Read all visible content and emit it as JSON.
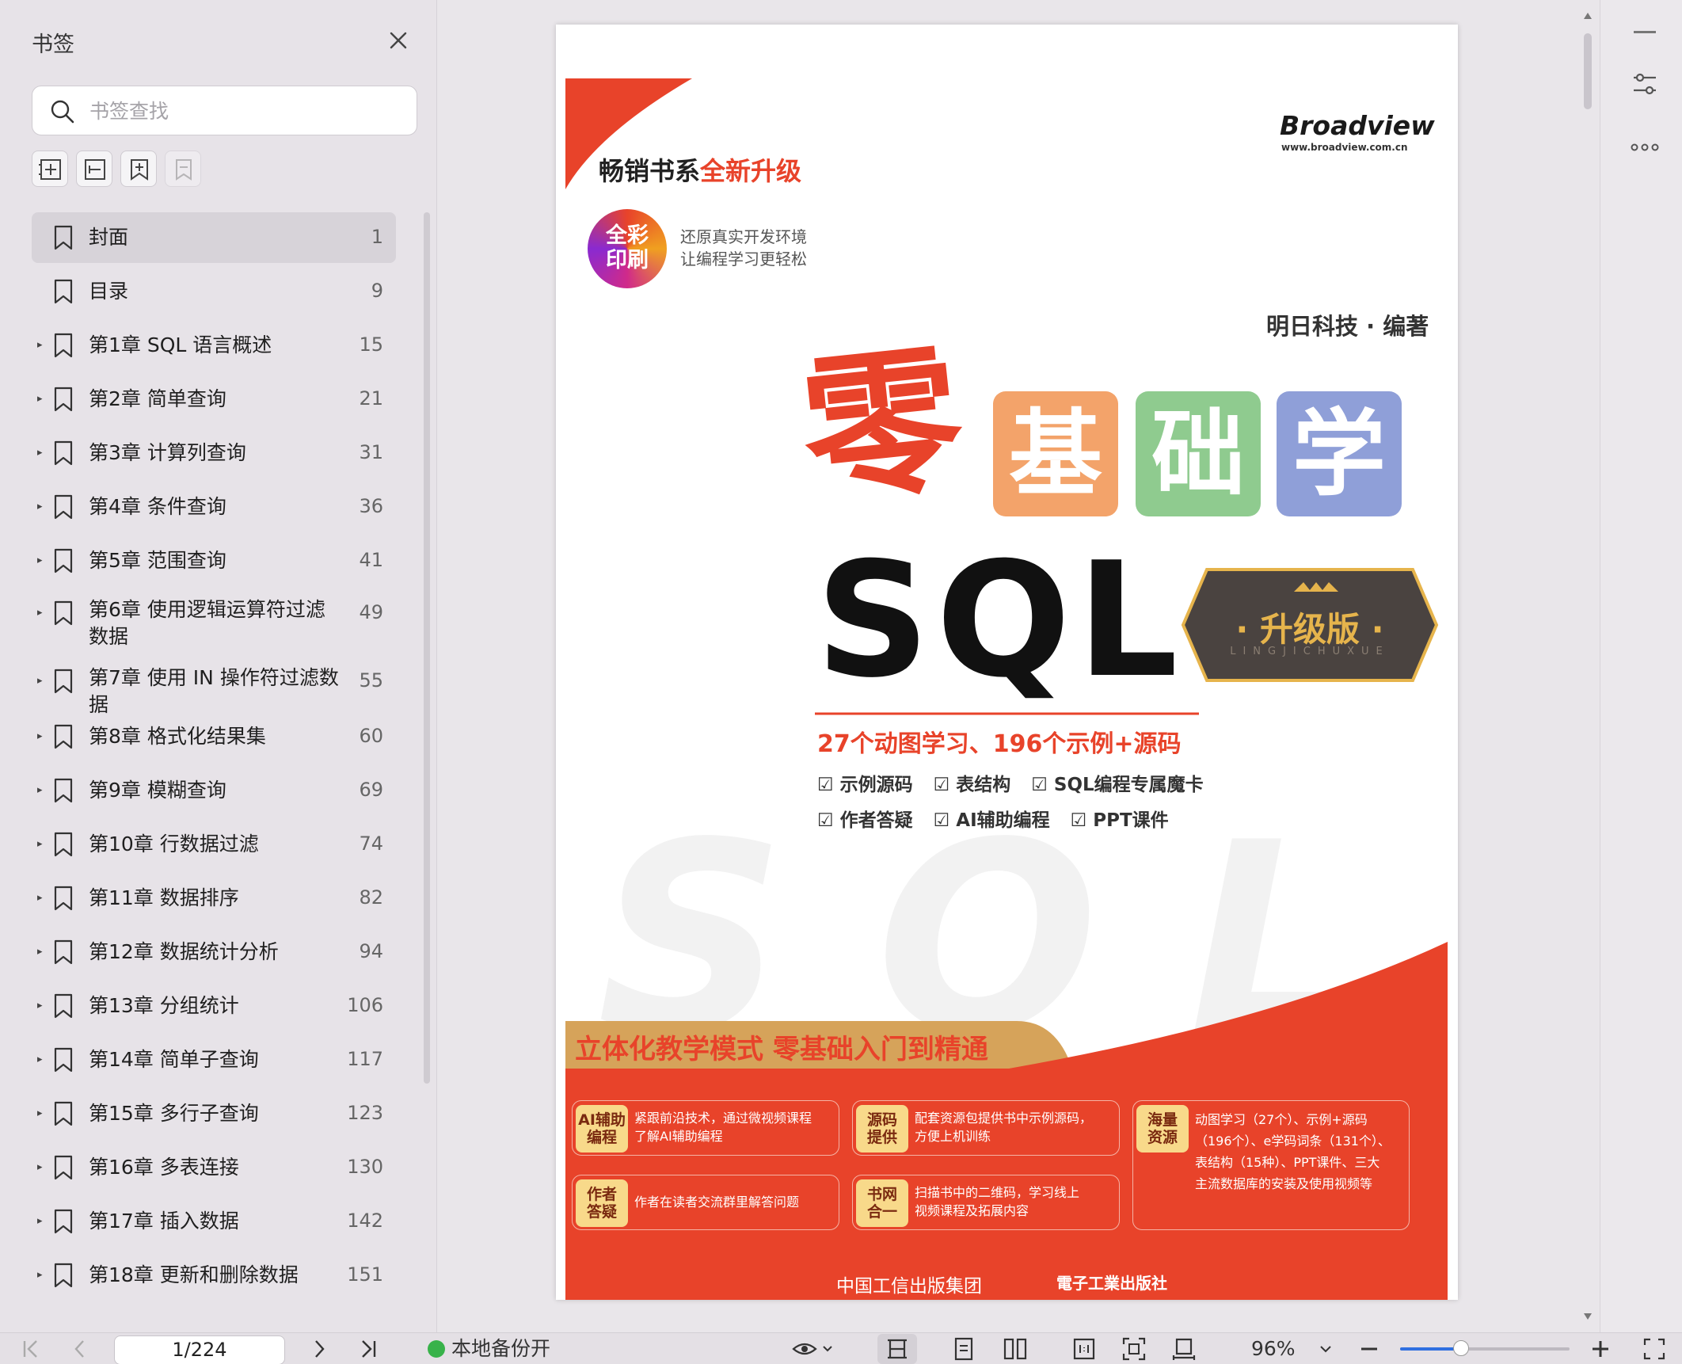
{
  "sidebar": {
    "title": "书签",
    "search_placeholder": "书签查找",
    "tools": [
      "expand-all-icon",
      "collapse-all-icon",
      "add-bookmark-icon",
      "remove-bookmark-icon"
    ],
    "items": [
      {
        "label": "封面",
        "page": "1",
        "expandable": false,
        "selected": true
      },
      {
        "label": "目录",
        "page": "9",
        "expandable": false
      },
      {
        "label": "第1章 SQL 语言概述",
        "page": "15",
        "expandable": true
      },
      {
        "label": "第2章 简单查询",
        "page": "21",
        "expandable": true
      },
      {
        "label": "第3章 计算列查询",
        "page": "31",
        "expandable": true
      },
      {
        "label": "第4章 条件查询",
        "page": "36",
        "expandable": true
      },
      {
        "label": "第5章 范围查询",
        "page": "41",
        "expandable": true
      },
      {
        "label": "第6章 使用逻辑运算符过滤数据",
        "page": "49",
        "expandable": true
      },
      {
        "label": "第7章 使用 IN 操作符过滤数据",
        "page": "55",
        "expandable": true
      },
      {
        "label": "第8章 格式化结果集",
        "page": "60",
        "expandable": true
      },
      {
        "label": "第9章 模糊查询",
        "page": "69",
        "expandable": true
      },
      {
        "label": "第10章 行数据过滤",
        "page": "74",
        "expandable": true
      },
      {
        "label": "第11章 数据排序",
        "page": "82",
        "expandable": true
      },
      {
        "label": "第12章 数据统计分析",
        "page": "94",
        "expandable": true
      },
      {
        "label": "第13章 分组统计",
        "page": "106",
        "expandable": true
      },
      {
        "label": "第14章 简单子查询",
        "page": "117",
        "expandable": true
      },
      {
        "label": "第15章 多行子查询",
        "page": "123",
        "expandable": true
      },
      {
        "label": "第16章 多表连接",
        "page": "130",
        "expandable": true
      },
      {
        "label": "第17章 插入数据",
        "page": "142",
        "expandable": true
      },
      {
        "label": "第18章 更新和删除数据",
        "page": "151",
        "expandable": true
      }
    ]
  },
  "cover": {
    "series_a": "畅销书系",
    "series_b": "全新升级",
    "badge_line1": "全彩",
    "badge_line2": "印刷",
    "tagline1": "还原真实开发环境",
    "tagline2": "让编程学习更轻松",
    "publisher_logo": "Broadview",
    "publisher_url": "www.broadview.com.cn",
    "author": "明日科技 · 编著",
    "title_ling": "零",
    "title_ji": "基",
    "title_chu": "础",
    "title_xue": "学",
    "title_sql": "SQL",
    "edition": "· 升级版 ·",
    "edition_sub": "LINGJICHUXUE",
    "stats": "27个动图学习、196个示例+源码",
    "features_row1": [
      "☑ 示例源码",
      "☑ 表结构",
      "☑ SQL编程专属魔卡"
    ],
    "features_row2": [
      "☑ 作者答疑",
      "☑ AI辅助编程",
      "☑ PPT课件"
    ],
    "banner": "立体化教学模式  零基础入门到精通",
    "boxes": [
      {
        "tag": "AI辅助\n编程",
        "text": "紧跟前沿技术，通过微视频课程\n了解AI辅助编程"
      },
      {
        "tag": "源码\n提供",
        "text": "配套资源包提供书中示例源码，\n方便上机训练"
      },
      {
        "tag": "作者\n答疑",
        "text": "作者在读者交流群里解答问题"
      },
      {
        "tag": "书网\n合一",
        "text": "扫描书中的二维码，学习线上\n视频课程及拓展内容"
      }
    ],
    "big_box_tag": "海量\n资源",
    "big_box_text": "动图学习（27个）、示例+源码\n（196个）、e学码词条（131个）、\n表结构（15种）、PPT课件、三大\n主流数据库的安装及使用视频等",
    "footer_pub1": "中国工信出版集团",
    "footer_pub2": "電子工業出版社"
  },
  "bottombar": {
    "page_indicator": "1/224",
    "backup_status": "本地备份开",
    "zoom": "96%",
    "zoom_fraction": 0.36
  },
  "colors": {
    "accent_red": "#e8432a",
    "orange_tile": "#f3a36a",
    "green_tile": "#8fcb8f",
    "blue_tile": "#8f9fd8",
    "badge_dark": "#4a4340",
    "gold": "#e6b44c"
  }
}
